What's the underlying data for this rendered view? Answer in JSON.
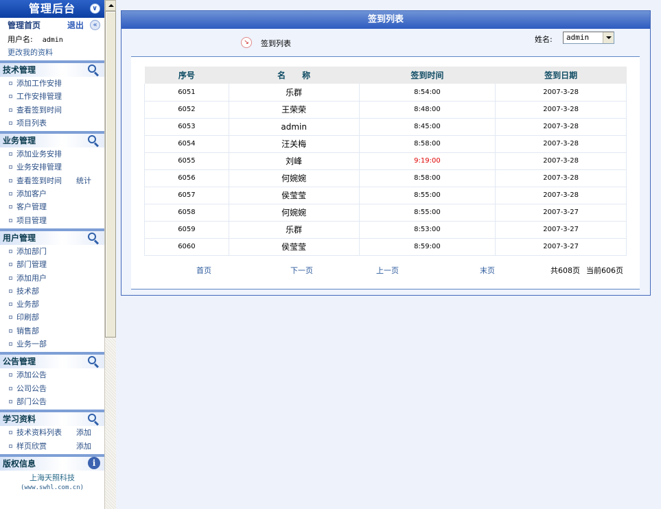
{
  "sidebar": {
    "title": "管理后台",
    "home": {
      "title": "管理首页",
      "logout": "退出"
    },
    "user": {
      "label": "用户名:",
      "value": "admin"
    },
    "edit_profile": "更改我的资料",
    "sections": [
      {
        "title": "技术管理",
        "icon": "search-icon",
        "items": [
          {
            "label": "添加工作安排"
          },
          {
            "label": "工作安排管理"
          },
          {
            "label": "查看签到时间"
          },
          {
            "label": "项目列表"
          }
        ]
      },
      {
        "title": "业务管理",
        "icon": "search-icon",
        "items": [
          {
            "label": "添加业务安排"
          },
          {
            "label": "业务安排管理"
          },
          {
            "label": "查看签到时间",
            "extra": "统计"
          },
          {
            "label": "添加客户"
          },
          {
            "label": "客户管理"
          },
          {
            "label": "项目管理"
          }
        ]
      },
      {
        "title": "用户管理",
        "icon": "search-icon",
        "items": [
          {
            "label": "添加部门"
          },
          {
            "label": "部门管理"
          },
          {
            "label": "添加用户"
          },
          {
            "label": "技术部"
          },
          {
            "label": "业务部"
          },
          {
            "label": "印刷部"
          },
          {
            "label": "销售部"
          },
          {
            "label": "业务一部"
          }
        ]
      },
      {
        "title": "公告管理",
        "icon": "search-icon",
        "items": [
          {
            "label": "添加公告"
          },
          {
            "label": "公司公告"
          },
          {
            "label": "部门公告"
          }
        ]
      },
      {
        "title": "学习资料",
        "icon": "search-icon",
        "items": [
          {
            "label": "技术资料列表",
            "extra": "添加"
          },
          {
            "label": "样页欣赏",
            "extra": "添加"
          }
        ]
      },
      {
        "title": "版权信息",
        "icon": "info-icon",
        "items": []
      }
    ],
    "copyright": {
      "company": "上海天照科技",
      "url": "(www.swhl.com.cn)"
    }
  },
  "panel": {
    "title": "签到列表",
    "breadcrumb": "签到列表",
    "filter": {
      "label": "姓名:",
      "value": "admin"
    },
    "table": {
      "headers": [
        "序号",
        "名　　称",
        "签到时间",
        "签到日期"
      ],
      "rows": [
        {
          "id": "6051",
          "name": "乐群",
          "time": "8:54:00",
          "date": "2007-3-28"
        },
        {
          "id": "6052",
          "name": "王荣荣",
          "time": "8:48:00",
          "date": "2007-3-28"
        },
        {
          "id": "6053",
          "name": "admin",
          "time": "8:45:00",
          "date": "2007-3-28"
        },
        {
          "id": "6054",
          "name": "汪关梅",
          "time": "8:58:00",
          "date": "2007-3-28"
        },
        {
          "id": "6055",
          "name": "刘峰",
          "time": "9:19:00",
          "date": "2007-3-28",
          "late": true
        },
        {
          "id": "6056",
          "name": "何婉婉",
          "time": "8:58:00",
          "date": "2007-3-28"
        },
        {
          "id": "6057",
          "name": "侯莹莹",
          "time": "8:55:00",
          "date": "2007-3-28"
        },
        {
          "id": "6058",
          "name": "何婉婉",
          "time": "8:55:00",
          "date": "2007-3-27"
        },
        {
          "id": "6059",
          "name": "乐群",
          "time": "8:53:00",
          "date": "2007-3-27"
        },
        {
          "id": "6060",
          "name": "侯莹莹",
          "time": "8:59:00",
          "date": "2007-3-27"
        }
      ]
    },
    "pager": {
      "first": "首页",
      "next": "下一页",
      "prev": "上一页",
      "last": "末页",
      "total": "共608页",
      "current": "当前606页"
    }
  },
  "colors": {
    "late_time": "#e00000",
    "title_bar": "#2d5bc0"
  }
}
